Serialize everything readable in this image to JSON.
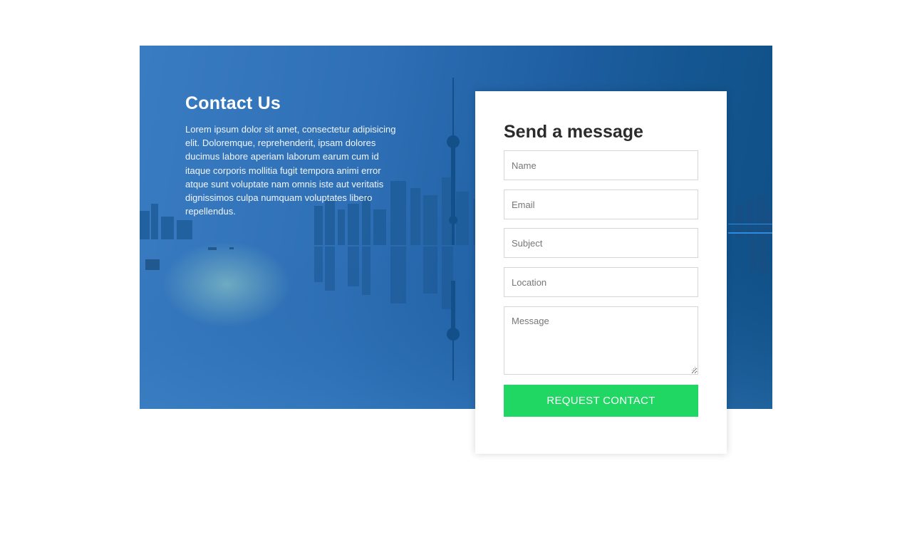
{
  "contact": {
    "title": "Contact Us",
    "description": "Lorem ipsum dolor sit amet, consectetur adipisicing elit. Doloremque, reprehenderit, ipsam dolores ducimus labore aperiam laborum earum cum id itaque corporis mollitia fugit tempora animi error atque sunt voluptate nam omnis iste aut veritatis dignissimos culpa numquam voluptates libero repellendus."
  },
  "form": {
    "title": "Send a message",
    "fields": {
      "name": {
        "placeholder": "Name",
        "value": ""
      },
      "email": {
        "placeholder": "Email",
        "value": ""
      },
      "subject": {
        "placeholder": "Subject",
        "value": ""
      },
      "location": {
        "placeholder": "Location",
        "value": ""
      },
      "message": {
        "placeholder": "Message",
        "value": ""
      }
    },
    "submit_label": "REQUEST CONTACT"
  },
  "colors": {
    "accent_button": "#21d764",
    "hero_blue": "#2e6fb5"
  }
}
